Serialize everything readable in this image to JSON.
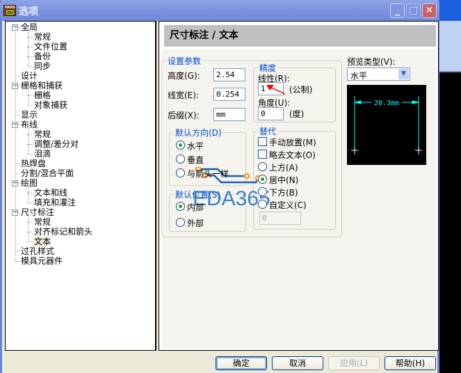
{
  "window": {
    "title": "选项",
    "app_icon_text": "PADS",
    "minimize": "_",
    "maximize": "□",
    "close": "✕"
  },
  "tree": {
    "items": [
      {
        "label": "全局",
        "level": 0,
        "expanded": true
      },
      {
        "label": "常规",
        "level": 1
      },
      {
        "label": "文件位置",
        "level": 1
      },
      {
        "label": "备份",
        "level": 1
      },
      {
        "label": "同步",
        "level": 1
      },
      {
        "label": "设计",
        "level": 0
      },
      {
        "label": "栅格和捕获",
        "level": 0,
        "expanded": true
      },
      {
        "label": "栅格",
        "level": 1
      },
      {
        "label": "对象捕获",
        "level": 1
      },
      {
        "label": "显示",
        "level": 0
      },
      {
        "label": "布线",
        "level": 0,
        "expanded": true
      },
      {
        "label": "常规",
        "level": 1
      },
      {
        "label": "调整/差分对",
        "level": 1
      },
      {
        "label": "泪滴",
        "level": 1
      },
      {
        "label": "热焊盘",
        "level": 0
      },
      {
        "label": "分割/混合平面",
        "level": 0
      },
      {
        "label": "绘图",
        "level": 0,
        "expanded": true
      },
      {
        "label": "文本和线",
        "level": 1
      },
      {
        "label": "填充和灌注",
        "level": 1
      },
      {
        "label": "尺寸标注",
        "level": 0,
        "expanded": true
      },
      {
        "label": "常规",
        "level": 1
      },
      {
        "label": "对齐标记和箭头",
        "level": 1
      },
      {
        "label": "文本",
        "level": 1,
        "selected": true
      },
      {
        "label": "过孔样式",
        "level": 0
      },
      {
        "label": "模具元器件",
        "level": 0
      }
    ]
  },
  "panel": {
    "header": "尺寸标注 / 文本",
    "settings": {
      "legend": "设置参数",
      "height_label": "高度(G):",
      "height": "2.54",
      "width_label": "线宽(E):",
      "width": "0.254",
      "suffix_label": "后缀(X):",
      "suffix": "mm"
    },
    "precision": {
      "legend": "精度",
      "linear_label": "线性(R):",
      "linear": "1",
      "linear_unit": "(公制)",
      "angle_label": "角度(U):",
      "angle": "0",
      "angle_unit": "(度)"
    },
    "orientation": {
      "legend": "默认方向(D)",
      "options": [
        {
          "label": "水平",
          "checked": true
        },
        {
          "label": "垂直",
          "checked": false
        },
        {
          "label": "与箭头一样",
          "checked": false
        }
      ]
    },
    "position": {
      "legend": "默认位置(S)",
      "options": [
        {
          "label": "内部",
          "checked": true
        },
        {
          "label": "外部",
          "checked": false
        }
      ]
    },
    "override": {
      "legend": "替代",
      "manual": "手动放置(M)",
      "manual_checked": false,
      "omit": "略去文本(O)",
      "omit_checked": false,
      "options": [
        {
          "label": "上方(A)",
          "checked": false
        },
        {
          "label": "居中(N)",
          "checked": true
        },
        {
          "label": "下方(B)",
          "checked": false
        },
        {
          "label": "自定义(C)",
          "checked": false
        }
      ],
      "custom_value": "0"
    },
    "preview": {
      "type_label": "预览类型(V):",
      "type_value": "水平",
      "dimension_text": "20.3mm"
    }
  },
  "buttons": {
    "ok": "确定",
    "cancel": "取消",
    "apply": "应用(L)",
    "help": "帮助(H)"
  },
  "watermark": "EDA365"
}
